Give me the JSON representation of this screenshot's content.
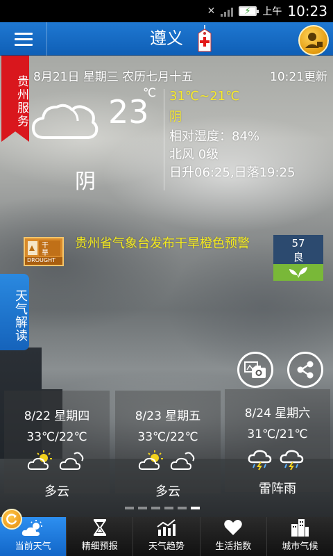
{
  "status_bar": {
    "ampm": "上午",
    "time": "10:23"
  },
  "header": {
    "city": "遵义"
  },
  "side": {
    "guizhou_service": "贵州服务",
    "weather_interpretation": "天气解读"
  },
  "current": {
    "date": "8月21日  星期三   农历七月十五",
    "update": "10:21更新",
    "temp": "23",
    "unit": "℃",
    "condition": "阴",
    "range": "31℃~21℃",
    "condition_detail": "阴",
    "humidity": "相对湿度：84%",
    "wind": "北风  0级",
    "sun": "日升06:25,日落19:25"
  },
  "alert": {
    "icon_label_top": "干",
    "icon_label_mid": "旱",
    "icon_label_bottom": "DROUGHT",
    "text": "贵州省气象台发布干旱橙色预警"
  },
  "aqi": {
    "value": "57",
    "level": "良"
  },
  "forecast": [
    {
      "date": "8/22  星期四",
      "temp": "33℃/22℃",
      "condition": "多云",
      "icon": "partly-cloudy-icon"
    },
    {
      "date": "8/23  星期五",
      "temp": "33℃/22℃",
      "condition": "多云",
      "icon": "partly-cloudy-icon"
    },
    {
      "date": "8/24  星期六",
      "temp": "31℃/21℃",
      "condition": "雷阵雨",
      "icon": "thunderstorm-icon"
    }
  ],
  "pager": {
    "count": 6,
    "active": 5
  },
  "nav": [
    {
      "label": "当前天气",
      "icon": "sun-cloud-icon",
      "active": true
    },
    {
      "label": "精细预报",
      "icon": "hourglass-icon",
      "active": false
    },
    {
      "label": "天气趋势",
      "icon": "trend-chart-icon",
      "active": false
    },
    {
      "label": "生活指数",
      "icon": "heart-icon",
      "active": false
    },
    {
      "label": "城市气候",
      "icon": "buildings-icon",
      "active": false
    }
  ],
  "colors": {
    "header_blue": "#1f78d2",
    "ribbon_red": "#d9171d",
    "alert_yellow": "#f4ea1e",
    "aqi_green": "#79b838"
  }
}
